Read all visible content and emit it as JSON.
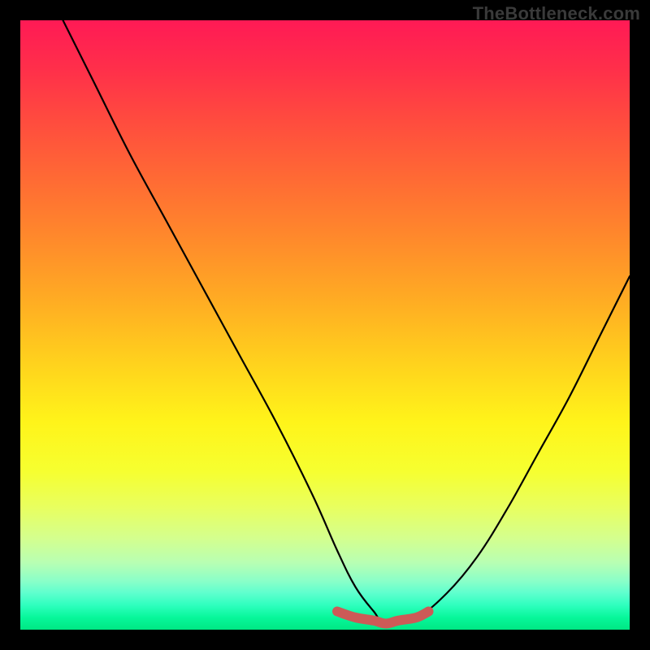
{
  "watermark": "TheBottleneck.com",
  "colors": {
    "frame": "#000000",
    "curve": "#000000",
    "bump": "#cd5a57",
    "gradient_stops": [
      "#ff1a55",
      "#ff2f4a",
      "#ff4a3f",
      "#ff6a34",
      "#ff8a2b",
      "#ffac23",
      "#ffd11d",
      "#fff41a",
      "#f6ff30",
      "#e8ff60",
      "#d4ff8e",
      "#b8ffb3",
      "#8affc8",
      "#5effce",
      "#2effbe",
      "#07f79a",
      "#00e884"
    ]
  },
  "chart_data": {
    "type": "line",
    "title": "",
    "xlabel": "",
    "ylabel": "",
    "xlim": [
      0,
      100
    ],
    "ylim": [
      0,
      100
    ],
    "note": "V-shaped bottleneck curve over vertical rainbow gradient. Axes unmarked; x/y treated as 0–100. Curve values estimated from pixels.",
    "series": [
      {
        "name": "bottleneck-curve",
        "x": [
          7,
          12,
          18,
          24,
          30,
          36,
          42,
          48,
          52,
          55,
          58,
          60,
          65,
          70,
          75,
          80,
          85,
          90,
          95,
          100
        ],
        "y": [
          100,
          90,
          78,
          67,
          56,
          45,
          34,
          22,
          13,
          7,
          3,
          1,
          2,
          6,
          12,
          20,
          29,
          38,
          48,
          58
        ]
      },
      {
        "name": "optimal-plateau",
        "x": [
          52,
          55,
          58,
          60,
          62,
          65,
          67
        ],
        "y": [
          3,
          2,
          1.5,
          1,
          1.5,
          2,
          3
        ]
      }
    ]
  }
}
